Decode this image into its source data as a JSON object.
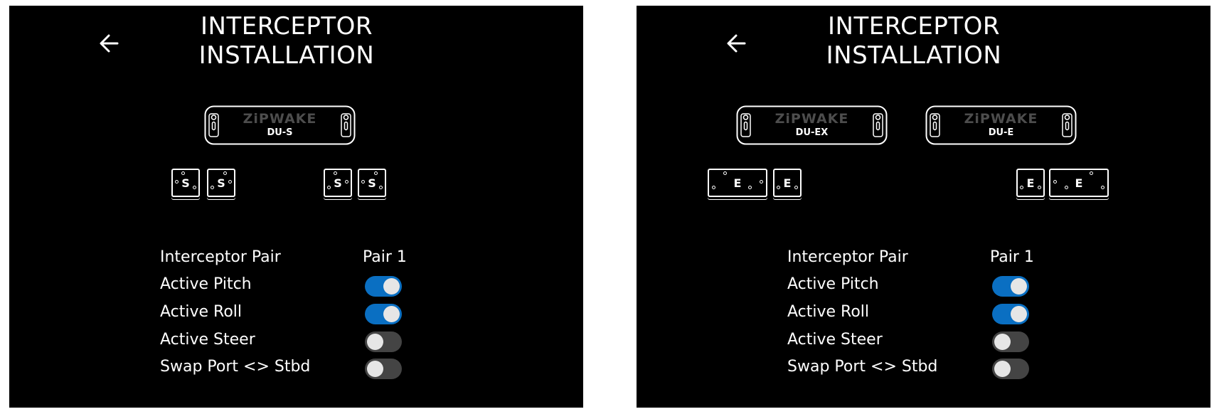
{
  "panels": [
    {
      "title_line1": "INTERCEPTOR",
      "title_line2": "INSTALLATION",
      "display_units": [
        {
          "brand": "ZiPWAKE",
          "label": "DU-S"
        }
      ],
      "interceptors": [
        "S",
        "S",
        "S",
        "S"
      ],
      "settings": {
        "pair_label": "Interceptor Pair",
        "pair_value": "Pair 1",
        "pitch_label": "Active Pitch",
        "pitch_on": true,
        "roll_label": "Active Roll",
        "roll_on": true,
        "steer_label": "Active Steer",
        "steer_on": false,
        "swap_label": "Swap Port <> Stbd",
        "swap_on": false
      }
    },
    {
      "title_line1": "INTERCEPTOR",
      "title_line2": "INSTALLATION",
      "display_units": [
        {
          "brand": "ZiPWAKE",
          "label": "DU-EX"
        },
        {
          "brand": "ZiPWAKE",
          "label": "DU-E"
        }
      ],
      "interceptors": [
        "E",
        "E",
        "E",
        "E"
      ],
      "settings": {
        "pair_label": "Interceptor Pair",
        "pair_value": "Pair 1",
        "pitch_label": "Active Pitch",
        "pitch_on": true,
        "roll_label": "Active Roll",
        "roll_on": true,
        "steer_label": "Active Steer",
        "steer_on": false,
        "swap_label": "Swap Port <> Stbd",
        "swap_on": false
      }
    }
  ],
  "colors": {
    "toggle_on": "#0a6fc2",
    "toggle_off": "#444444",
    "background": "#000000",
    "foreground": "#ffffff"
  },
  "icons": {
    "back": "arrow-left-icon",
    "mount_hole": "keyhole-icon"
  }
}
